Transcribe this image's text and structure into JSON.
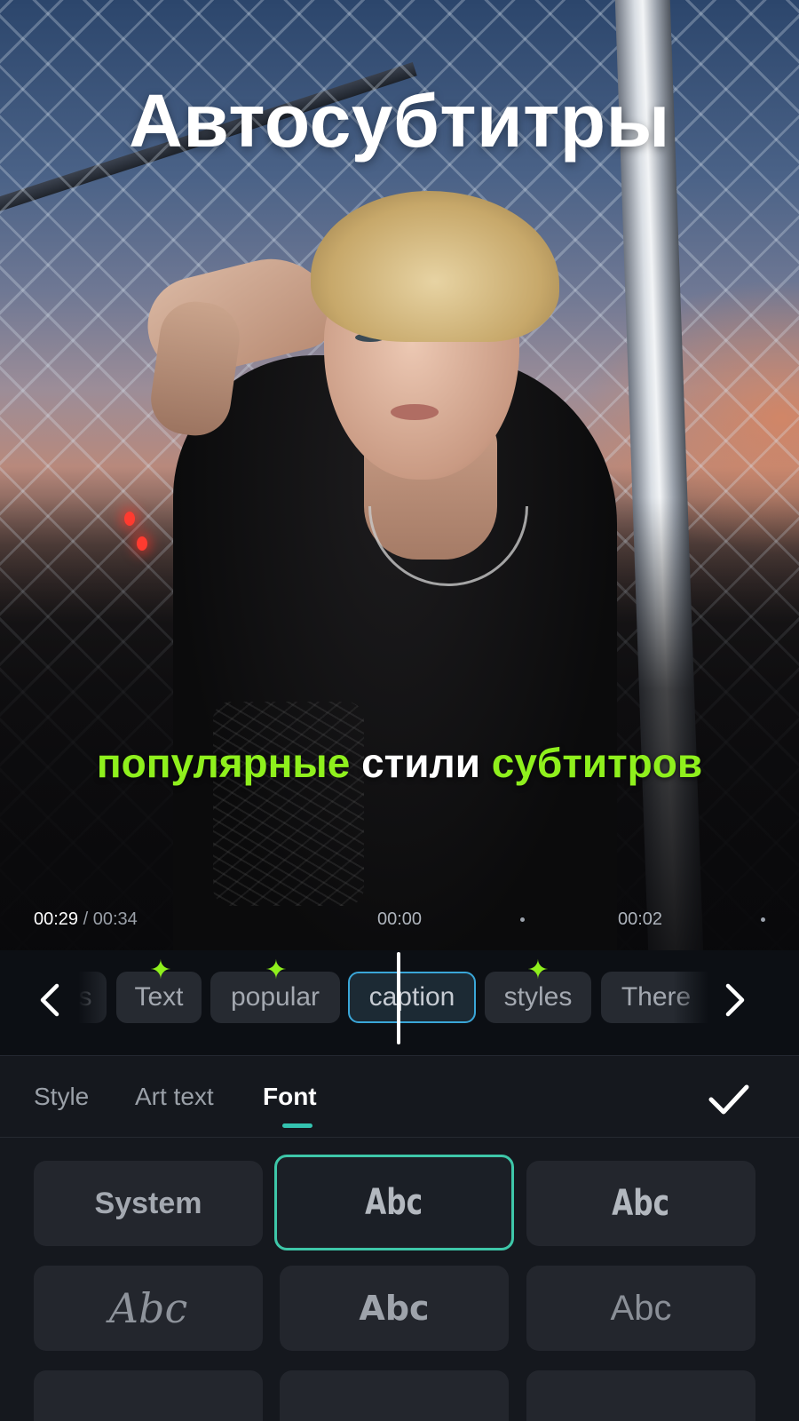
{
  "preview": {
    "headline": "Автосубтитры",
    "caption": {
      "word1": "популярные",
      "word2": "стили",
      "word3": "субтитров"
    },
    "time_current": "00:29",
    "time_total": " / 00:34",
    "timeline_mark_1": "00:00",
    "timeline_mark_2": "00:02"
  },
  "word_timeline": {
    "chips": [
      {
        "label": "s",
        "highlighted": false,
        "selected": false
      },
      {
        "label": "Text",
        "highlighted": true,
        "selected": false
      },
      {
        "label": "popular",
        "highlighted": true,
        "selected": false
      },
      {
        "label": "caption",
        "highlighted": false,
        "selected": true
      },
      {
        "label": "styles",
        "highlighted": true,
        "selected": false
      },
      {
        "label": "There",
        "highlighted": false,
        "selected": false
      }
    ],
    "prev_icon": "chevron-left-icon",
    "next_icon": "chevron-right-icon"
  },
  "panel": {
    "tabs": [
      {
        "label": "Style",
        "active": false
      },
      {
        "label": "Art text",
        "active": false
      },
      {
        "label": "Font",
        "active": true
      }
    ],
    "confirm_icon": "checkmark-icon",
    "fonts": [
      {
        "label": "System",
        "selected": false
      },
      {
        "label": "Abc",
        "selected": true
      },
      {
        "label": "Abc",
        "selected": false
      },
      {
        "label": "Abc",
        "selected": false
      },
      {
        "label": "Abc",
        "selected": false
      },
      {
        "label": "Abc",
        "selected": false
      }
    ]
  },
  "colors": {
    "accent_green": "#8ff01d",
    "selected_chip_border": "#3aa6d8",
    "selected_font_border": "#3ec7a9",
    "tab_indicator": "#34c3b0",
    "panel_bg": "#15181e"
  }
}
